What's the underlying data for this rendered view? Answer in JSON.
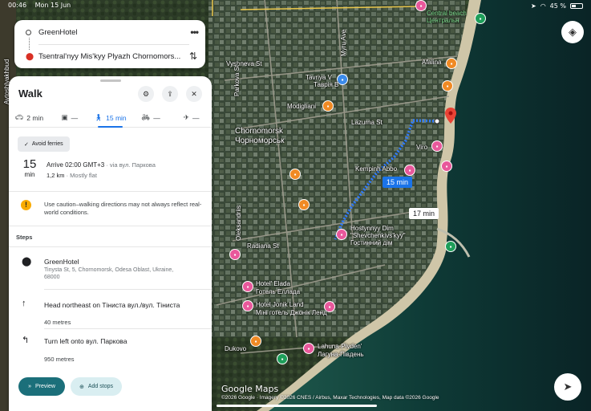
{
  "status_bar": {
    "time": "00:46",
    "date": "Mon 15 Jun",
    "battery": "45 %",
    "battery_level": 0.45
  },
  "route": {
    "origin": "GreenHotel",
    "destination": "Tsentral'nyy Mis'kyy Plyazh Chornomors...",
    "more_icon": "more-dots-icon",
    "swap_icon": "swap-icon"
  },
  "panel": {
    "title": "Walk",
    "modes": [
      {
        "label": "2 min",
        "icon": "car-icon",
        "active": false
      },
      {
        "label": "—",
        "icon": "transit-icon",
        "active": false
      },
      {
        "label": "15 min",
        "icon": "walk-icon",
        "active": true
      },
      {
        "label": "—",
        "icon": "bike-icon",
        "active": false
      },
      {
        "label": "—",
        "icon": "plane-icon",
        "active": false
      }
    ],
    "avoid_ferries": "Avoid ferries",
    "summary": {
      "minutes": "15",
      "unit": "min",
      "arrive": "Arrive 02:00 GMT+3",
      "via": " · via вул. Паркова",
      "distance": "1,2 km",
      "terrain": " · Mostly flat"
    },
    "warning": "Use caution–walking directions may not always reflect real-world conditions.",
    "steps_title": "Steps",
    "steps": [
      {
        "main": "GreenHotel",
        "sub": "Tinysta St, 5, Chornomorsk, Odesa Oblast, Ukraine, 68000",
        "distance": ""
      },
      {
        "main": "Head northeast on Тіниста вул./вул. Тіниста",
        "sub": "",
        "distance": "40 metres"
      },
      {
        "main": "Turn left onto вул. Паркова",
        "sub": "",
        "distance": "950 metres"
      }
    ],
    "preview_label": "Preview",
    "add_stops_label": "Add stops"
  },
  "map": {
    "duration_primary": "15 min",
    "duration_alt": "17 min",
    "labels": {
      "city_en": "Chornomorsk",
      "city_ua": "Чорноморськ",
      "central_beach": "Central beach",
      "afalina": "Afalina",
      "viro": "Viro",
      "kempinh": "Kempinh Abbo",
      "tavriya": "Tavriya V",
      "tavriya_ua": "Таврія В",
      "modigliani": "Modigliani",
      "hostynnyy": "Hostynnyy Dim",
      "hostynnyy2": "\"Shevchenkivs'kyy\"",
      "hostynnyy_ua": "Гостинний дім",
      "elada": "Hotel' Elada",
      "elada_ua": "Готель Еллада",
      "jonik": "Hotel Jonik Land",
      "jonik_ua": "Міні готель Джонік Ленд",
      "lahuna": "Lahuna-Pivden'",
      "lahuna_ua": "Лагуна-Південь",
      "dukovo": "Dukovo",
      "lazurna": "Lazurna St",
      "radiana": "Radiana St",
      "oleksandriis": "Oleksandriis",
      "avtoshlyakhbud": "Avtoshlyakhbud",
      "vyshneva": "Vyshneva St",
      "myru": "Myru Ave",
      "parkova": "Parkova St",
      "tsentral": "Центральн"
    },
    "google_logo": "Google Maps",
    "attribution": "©2026 Google · Imagery ©2026 CNES / Airbus, Maxar Technologies, Map data ©2026 Google",
    "layers_icon": "layers-icon",
    "locate_icon": "navigation-arrow-icon"
  }
}
